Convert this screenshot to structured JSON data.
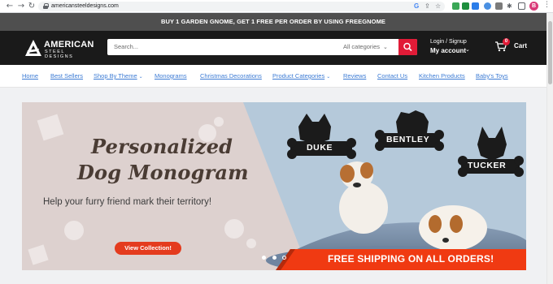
{
  "browser": {
    "url": "americansteeldesigns.com",
    "profile_initial": "B",
    "icons": [
      "back-icon",
      "forward-icon",
      "reload-icon",
      "lock-icon",
      "google-icon",
      "share-icon",
      "star-icon",
      "extensions-icon",
      "kebab-menu-icon"
    ]
  },
  "promo_bar": {
    "text": "BUY 1 GARDEN GNOME, GET 1 FREE PER ORDER BY USING FREEGNOME",
    "bg": "#4f4f4f"
  },
  "header": {
    "logo_text": "AMERICAN",
    "logo_subtext": "STEEL DESIGNS",
    "search_placeholder": "Search...",
    "category_label": "All categories",
    "login_label": "Login / Signup",
    "account_label": "My account",
    "cart_count": "0",
    "cart_label": "Cart",
    "accent": "#e11b37"
  },
  "nav": {
    "items": [
      {
        "label": "Home"
      },
      {
        "label": "Best Sellers"
      },
      {
        "label": "Shop By Theme"
      },
      {
        "label": "Monograms"
      },
      {
        "label": "Christmas Decorations"
      },
      {
        "label": "Product Categories"
      },
      {
        "label": "Reviews"
      },
      {
        "label": "Contact Us"
      },
      {
        "label": "Kitchen Products"
      },
      {
        "label": "Baby's Toys"
      }
    ]
  },
  "hero": {
    "title_line1": "Personalized",
    "title_line2": "Dog Monogram",
    "subtitle": "Help your furry friend mark their territory!",
    "cta": "View Collection!",
    "shipping_banner": "FREE SHIPPING ON ALL ORDERS!",
    "pet_names": [
      "DUKE",
      "BENTLEY",
      "TUCKER"
    ],
    "slides_count": 3,
    "active_slide": 3,
    "banner_color": "#f03a12"
  }
}
